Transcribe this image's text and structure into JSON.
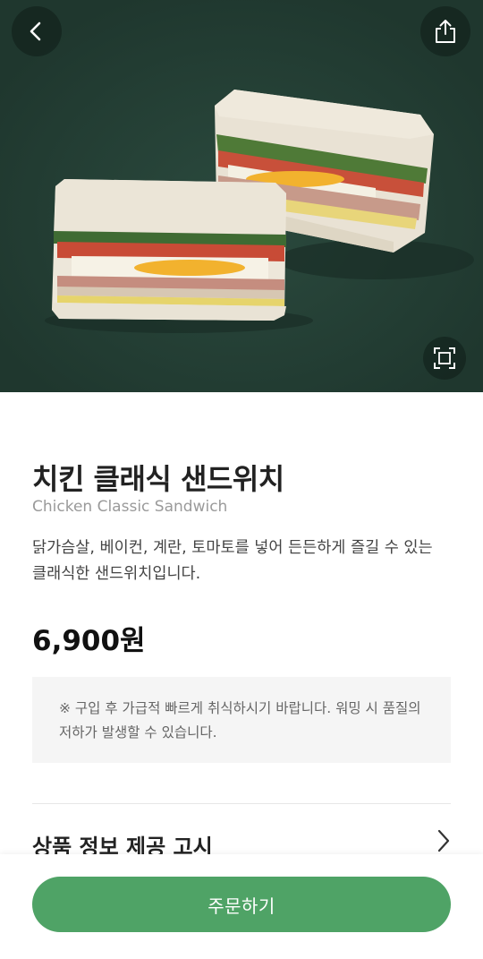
{
  "colors": {
    "hero_background": "#223d33",
    "accent_green": "#4fa366",
    "notice_background": "#f5f5f5"
  },
  "icons": {
    "back": "chevron-left-icon",
    "share": "share-icon",
    "zoom": "expand-icon",
    "info_chevron": "chevron-right-icon"
  },
  "product": {
    "name_kr": "치킨 클래식 샌드위치",
    "name_en": "Chicken Classic Sandwich",
    "description": "닭가슴살, 베이컨, 계란, 토마토를 넣어 든든하게 즐길 수 있는 클래식한 샌드위치입니다.",
    "price": "6,900원"
  },
  "notice": {
    "text": "※ 구입 후 가급적 빠르게 취식하시기 바랍니다. 워밍 시 품질의 저하가 발생할 수 있습니다."
  },
  "info": {
    "label": "상품 정보 제공 고시"
  },
  "actions": {
    "order_label": "주문하기"
  }
}
